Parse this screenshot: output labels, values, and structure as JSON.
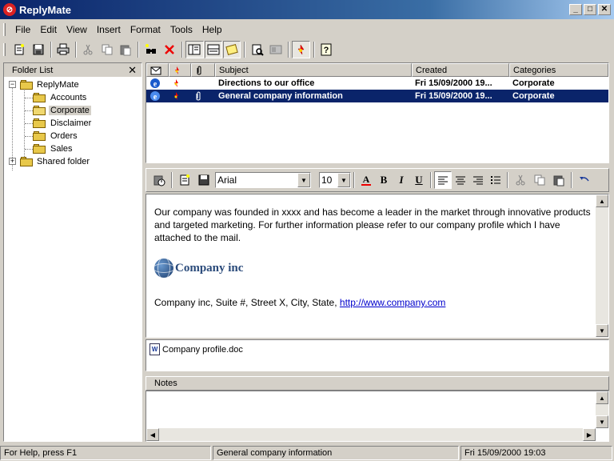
{
  "window": {
    "title": "ReplyMate",
    "min_label": "_",
    "max_label": "□",
    "close_label": "✕"
  },
  "menu": {
    "items": [
      {
        "label": "File"
      },
      {
        "label": "Edit"
      },
      {
        "label": "View"
      },
      {
        "label": "Insert"
      },
      {
        "label": "Format"
      },
      {
        "label": "Tools"
      },
      {
        "label": "Help"
      }
    ]
  },
  "toolbar": {
    "icons": [
      "new-message-icon",
      "save-icon",
      "print-icon",
      "cut-icon",
      "copy-icon",
      "paste-icon",
      "find-icon",
      "delete-icon",
      "folder-list-icon",
      "preview-pane-icon",
      "notes-icon",
      "search-icon",
      "address-book-icon",
      "high-priority-icon",
      "help-icon"
    ]
  },
  "folders": {
    "header": "Folder List",
    "close_label": "✕",
    "root": "ReplyMate",
    "items": [
      {
        "label": "Accounts"
      },
      {
        "label": "Corporate"
      },
      {
        "label": "Disclaimer"
      },
      {
        "label": "Orders"
      },
      {
        "label": "Sales"
      }
    ],
    "shared": "Shared folder",
    "selected": "Corporate"
  },
  "message_list": {
    "columns": {
      "subject": "Subject",
      "created": "Created",
      "categories": "Categories"
    },
    "rows": [
      {
        "subject": "Directions to our office",
        "created": "Fri 15/09/2000 19...",
        "category": "Corporate"
      },
      {
        "subject": "General company information",
        "created": "Fri 15/09/2000 19...",
        "category": "Corporate"
      }
    ]
  },
  "editor": {
    "font": "Arial",
    "size": "10",
    "bold": "B",
    "italic": "I",
    "underline": "U",
    "body_text": "Our company was founded in xxxx and has become a leader in the market through innovative products and targeted marketing. For further information please refer to our company profile which I have attached to the mail.",
    "logo_text": "Company inc",
    "address_text": "Company inc, Suite #, Street X, City, State, ",
    "link": "http://www.company.com"
  },
  "attachments": [
    {
      "name": "Company profile.doc"
    }
  ],
  "notes": {
    "header": "Notes"
  },
  "status": {
    "help": "For Help, press F1",
    "subject": "General company information",
    "date": "Fri 15/09/2000 19:03"
  },
  "colors": {
    "selection": "#0a246a",
    "titlebar": "#0a246a",
    "link": "#0000cc"
  }
}
